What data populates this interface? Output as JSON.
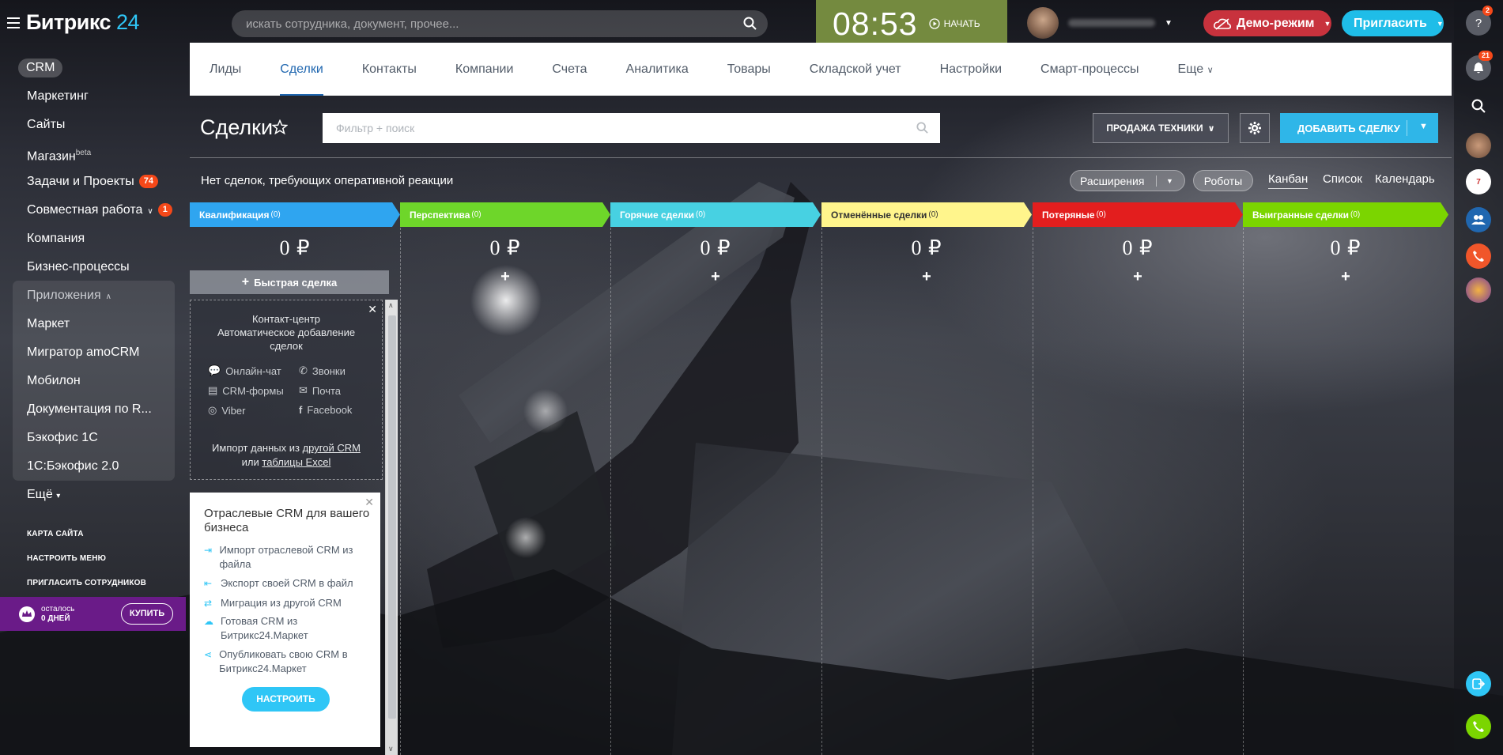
{
  "app": {
    "logo_text": "Битрикс",
    "logo_num": "24"
  },
  "search": {
    "placeholder": "искать сотрудника, документ, прочее..."
  },
  "clock": {
    "time": "08:53",
    "start_label": "НАЧАТЬ"
  },
  "header": {
    "demo_label": "Демо-режим",
    "invite_label": "Пригласить"
  },
  "left_menu": {
    "items": [
      {
        "label": "CRM"
      },
      {
        "label": "Маркетинг"
      },
      {
        "label": "Сайты"
      },
      {
        "label": "Магазин",
        "sup": "beta"
      },
      {
        "label": "Задачи и Проекты",
        "badge": "74"
      },
      {
        "label": "Совместная работа",
        "badge": "1"
      },
      {
        "label": "Компания"
      },
      {
        "label": "Бизнес-процессы"
      },
      {
        "label": "Приложения"
      },
      {
        "label": "Маркет"
      },
      {
        "label": "Мигратор amoCRM"
      },
      {
        "label": "Мобилон"
      },
      {
        "label": "Документация по R..."
      },
      {
        "label": "Бэкофис 1С"
      },
      {
        "label": "1С:Бэкофис 2.0"
      },
      {
        "label": "Ещё"
      }
    ],
    "sitemap": "КАРТА САЙТА",
    "configure_menu": "НАСТРОИТЬ МЕНЮ",
    "invite_employees": "ПРИГЛАСИТЬ СОТРУДНИКОВ",
    "promo_line1": "осталось",
    "promo_line2": "0 ДНЕЙ",
    "promo_buy": "КУПИТЬ"
  },
  "right_panel": {
    "help_badge": "2",
    "notif_badge": "21"
  },
  "tabs": [
    "Лиды",
    "Сделки",
    "Контакты",
    "Компании",
    "Счета",
    "Аналитика",
    "Товары",
    "Складской учет",
    "Настройки",
    "Смарт-процессы",
    "Еще"
  ],
  "page": {
    "title": "Сделки",
    "filter_placeholder": "Фильтр + поиск",
    "category_button": "ПРОДАЖА ТЕХНИКИ",
    "add_button": "ДОБАВИТЬ СДЕЛКУ",
    "subtitle": "Нет сделок, требующих оперативной реакции",
    "extensions": "Расширения",
    "robots": "Роботы",
    "views": [
      "Канбан",
      "Список",
      "Календарь"
    ]
  },
  "stages": [
    {
      "name": "Квалификация",
      "count": "(0)",
      "sum": "0 ₽",
      "color": "#2fa5f0"
    },
    {
      "name": "Перспектива",
      "count": "(0)",
      "sum": "0 ₽",
      "color": "#6ed62a"
    },
    {
      "name": "Горячие сделки",
      "count": "(0)",
      "sum": "0 ₽",
      "color": "#47d1e2"
    },
    {
      "name": "Отменённые сделки",
      "count": "(0)",
      "sum": "0 ₽",
      "color": "#fff58c"
    },
    {
      "name": "Потеряные",
      "count": "(0)",
      "sum": "0 ₽",
      "color": "#e31e1e"
    },
    {
      "name": "Выигранные сделки",
      "count": "(0)",
      "sum": "0 ₽",
      "color": "#7bd500"
    }
  ],
  "quick_deal": "Быстрая сделка",
  "contact_center": {
    "title": "Контакт-центр",
    "line2": "Автоматическое добавление",
    "line3": "сделок",
    "channels": [
      "Онлайн-чат",
      "Звонки",
      "CRM-формы",
      "Почта",
      "Viber",
      "Facebook"
    ],
    "import_prefix": "Импорт данных из",
    "import_link1": "другой CRM",
    "import_or": "или",
    "import_link2": "таблицы Excel"
  },
  "industry_card": {
    "title": "Отраслевые CRM для вашего бизнеса",
    "items": [
      "Импорт отраслевой CRM из файла",
      "Экспорт своей CRM в файл",
      "Миграция из другой CRM",
      "Готовая CRM из Битрикс24.Маркет",
      "Опубликовать свою CRM в Битрикс24.Маркет"
    ],
    "button": "НАСТРОИТЬ"
  }
}
